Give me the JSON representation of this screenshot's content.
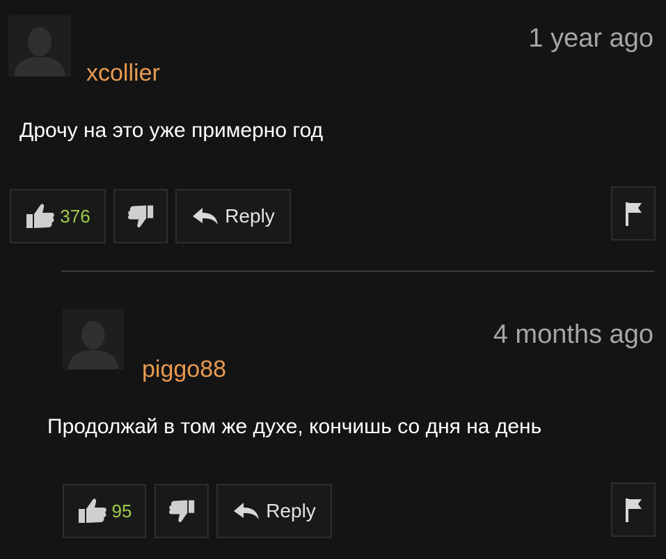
{
  "comments": [
    {
      "username": "xcollier",
      "timestamp": "1 year ago",
      "text": "Дрочу на это уже примерно год",
      "likes": "376",
      "reply_label": "Reply"
    },
    {
      "username": "piggo88",
      "timestamp": "4 months ago",
      "text": "Продолжай в том же духе, кончишь со дня на день",
      "likes": "95",
      "reply_label": "Reply"
    }
  ],
  "colors": {
    "background": "#141414",
    "username": "#e89a52",
    "like_count": "#9fcc4d",
    "timestamp": "#a6a6a6",
    "text": "#ffffff"
  },
  "icons": {
    "avatar": "avatar-placeholder-icon",
    "like": "thumbs-up-icon",
    "dislike": "thumbs-down-icon",
    "reply": "reply-arrow-icon",
    "flag": "flag-icon"
  }
}
